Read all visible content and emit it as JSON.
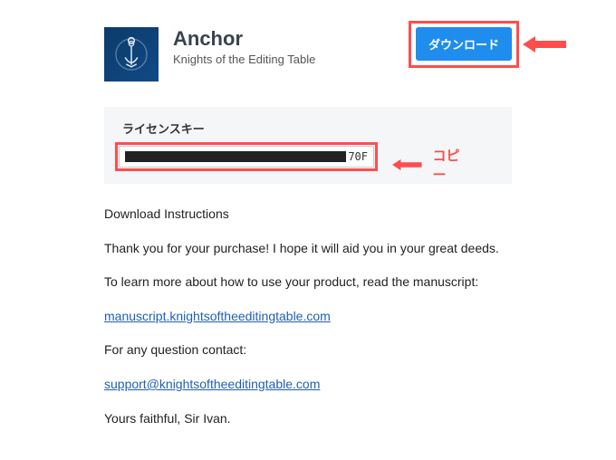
{
  "header": {
    "title": "Anchor",
    "subtitle": "Knights of the Editing Table",
    "download_label": "ダウンロード"
  },
  "license": {
    "label": "ライセンスキー",
    "visible_suffix": "70F"
  },
  "annotations": {
    "copy_label": "コピー"
  },
  "instructions": {
    "heading": "Download Instructions",
    "thankyou": "Thank you for your purchase! I hope it will aid you in your great deeds.",
    "learn_more": "To learn more about how to use your product, read the manuscript:",
    "manuscript_link": "manuscript.knightsoftheeditingtable.com",
    "question": "For any question contact:",
    "support_link": "support@knightsoftheeditingtable.com",
    "signoff": "Yours faithful, Sir Ivan."
  }
}
